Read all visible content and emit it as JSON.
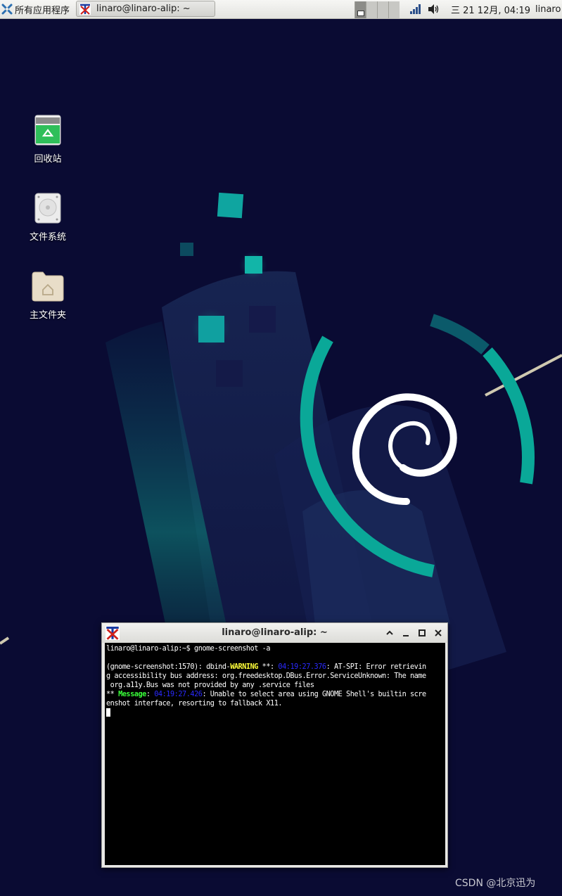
{
  "panel": {
    "apps_menu_label": "所有应用程序",
    "taskbar_window_title": "linaro@linaro-alip: ~",
    "clock": "三 21 12月, 04:19",
    "user": "linaro"
  },
  "desktop": {
    "icons": [
      {
        "label": "回收站"
      },
      {
        "label": "文件系统"
      },
      {
        "label": "主文件夹"
      }
    ]
  },
  "terminal": {
    "title": "linaro@linaro-alip: ~",
    "prompt_line": "linaro@linaro-alip:~$ gnome-screenshot -a",
    "warning_prefix": "(gnome-screenshot:1570): dbind-",
    "warning_word": "WARNING",
    "warning_stars": " **: ",
    "warning_time": "04:19:27.376",
    "warning_text": ": AT-SPI: Error retrieving accessibility bus address: org.freedesktop.DBus.Error.ServiceUnknown: The name org.a11y.Bus was not provided by any .service files",
    "message_prefix": "** ",
    "message_word": "Message",
    "message_sep": ": ",
    "message_time": "04:19:27.426",
    "message_text": ": Unable to select area using GNOME Shell's builtin screenshot interface, resorting to fallback X11."
  },
  "watermark": "CSDN @北京迅为",
  "colors": {
    "wallpaper": "#0a0b33",
    "swirl_teal": "#0aa898",
    "terminal_bg": "#000000",
    "warning": "#ffff3a",
    "message": "#3aff3a",
    "timestamp": "#2a2aff"
  }
}
